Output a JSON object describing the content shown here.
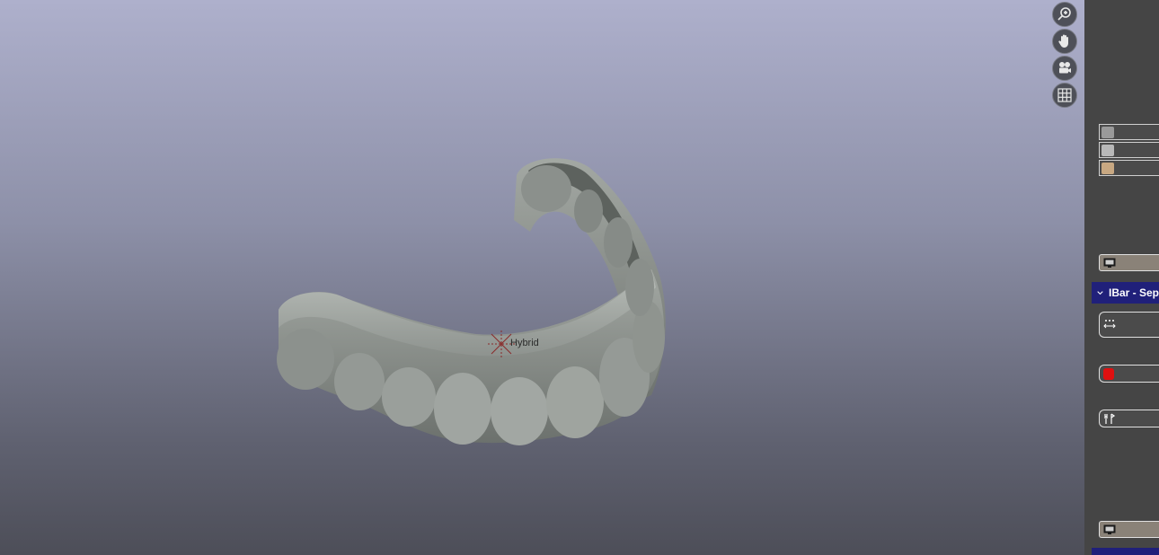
{
  "viewport": {
    "pivot_label": "Hybrid"
  },
  "nav_tools": [
    {
      "name": "zoom-icon"
    },
    {
      "name": "pan-hand-icon"
    },
    {
      "name": "camera-icon"
    },
    {
      "name": "grid-icon"
    }
  ],
  "layers": [
    {
      "name": "layer-thumbnail-1",
      "color": "#9a9a9a"
    },
    {
      "name": "layer-thumbnail-2",
      "color": "#b8b8b8"
    },
    {
      "name": "layer-thumbnail-3",
      "color": "#c8a882"
    }
  ],
  "panel": {
    "section_title": "IBar - Sep",
    "colors": {
      "header": "#20207a",
      "red_swatch": "#e01010"
    }
  }
}
